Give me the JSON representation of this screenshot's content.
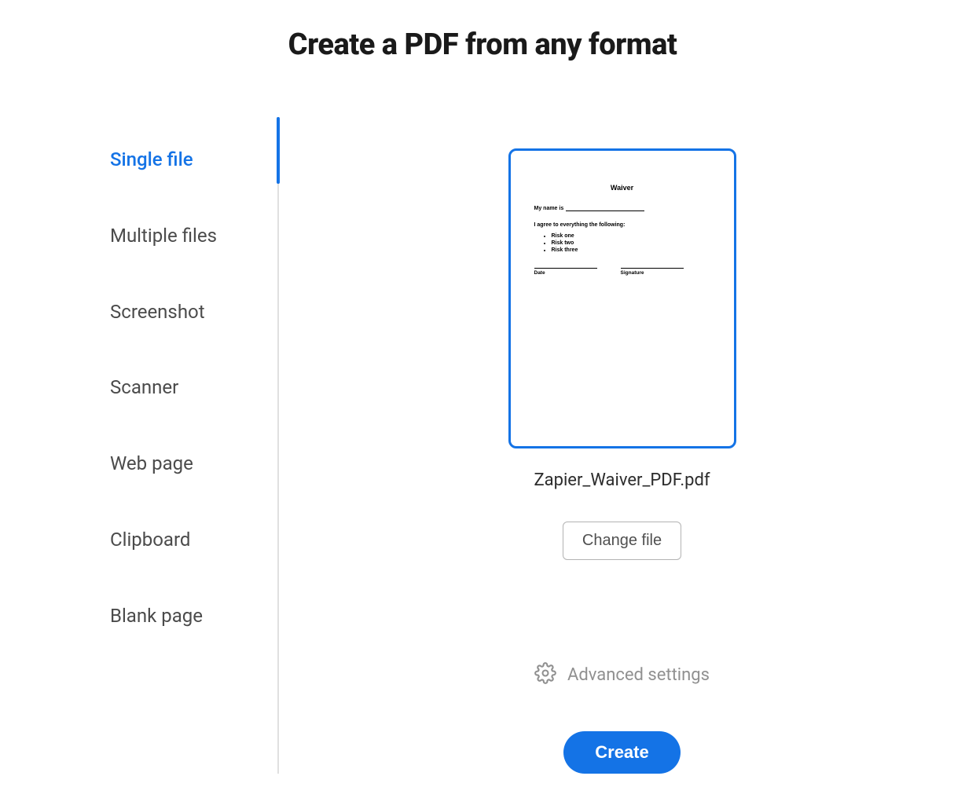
{
  "title": "Create a PDF from any format",
  "sidebar": {
    "items": [
      {
        "label": "Single file",
        "active": true
      },
      {
        "label": "Multiple files",
        "active": false
      },
      {
        "label": "Screenshot",
        "active": false
      },
      {
        "label": "Scanner",
        "active": false
      },
      {
        "label": "Web page",
        "active": false
      },
      {
        "label": "Clipboard",
        "active": false
      },
      {
        "label": "Blank page",
        "active": false
      }
    ]
  },
  "preview": {
    "doc_title": "Waiver",
    "name_prefix": "My name is",
    "agree_text": "I agree to everything the following:",
    "bullets": [
      "Risk one",
      "Risk two",
      "Risk three"
    ],
    "date_label": "Date",
    "signature_label": "Signature"
  },
  "file_name": "Zapier_Waiver_PDF.pdf",
  "buttons": {
    "change_file": "Change file",
    "create": "Create"
  },
  "advanced": {
    "label": "Advanced settings"
  },
  "colors": {
    "primary": "#1473e6",
    "muted": "#909090"
  }
}
